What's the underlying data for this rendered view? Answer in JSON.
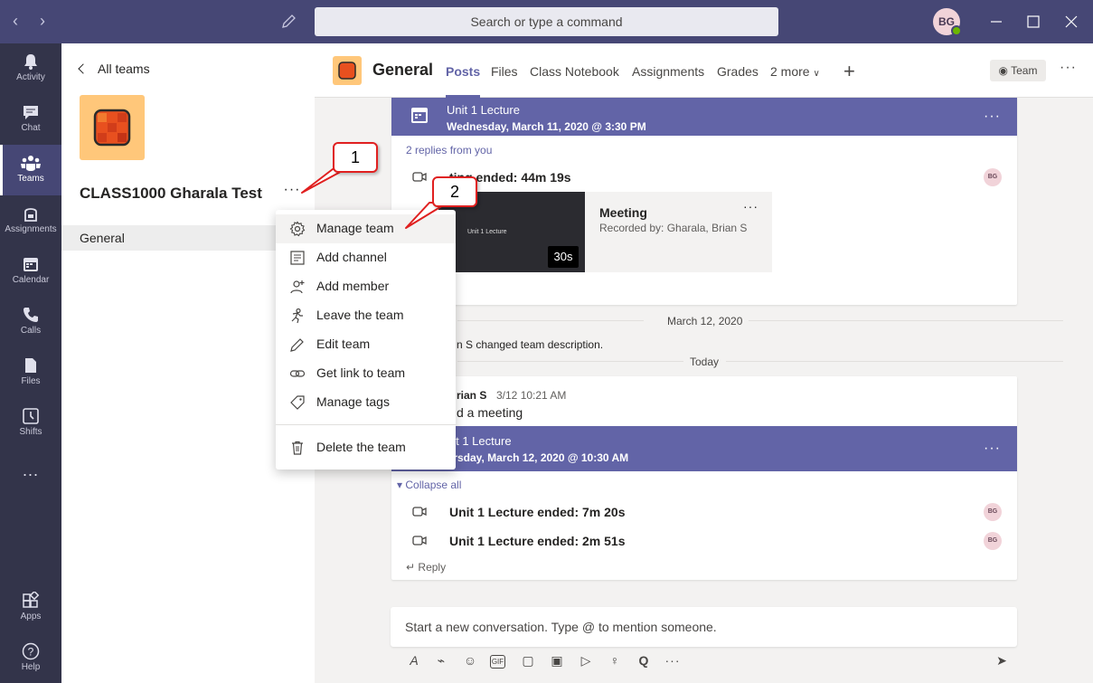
{
  "titlebar": {
    "search_placeholder": "Search or type a command",
    "avatar_initials": "BG"
  },
  "rail": {
    "items": [
      {
        "label": "Activity",
        "icon": "bell-icon"
      },
      {
        "label": "Chat",
        "icon": "chat-icon"
      },
      {
        "label": "Teams",
        "icon": "teams-icon",
        "active": true
      },
      {
        "label": "Assignments",
        "icon": "assignments-icon"
      },
      {
        "label": "Calendar",
        "icon": "calendar-icon"
      },
      {
        "label": "Calls",
        "icon": "phone-icon"
      },
      {
        "label": "Files",
        "icon": "file-icon"
      },
      {
        "label": "Shifts",
        "icon": "clock-icon"
      },
      {
        "label": "...",
        "icon": "more-icon"
      }
    ],
    "bottom": [
      {
        "label": "Apps",
        "icon": "apps-icon"
      },
      {
        "label": "Help",
        "icon": "help-icon"
      }
    ]
  },
  "team_panel": {
    "all_teams": "All teams",
    "team_name": "CLASS1000 Gharala Test",
    "more": "···",
    "channels": [
      "General"
    ]
  },
  "channel": {
    "title": "General",
    "tabs": [
      "Posts",
      "Files",
      "Class Notebook",
      "Assignments",
      "Grades",
      "2 more"
    ],
    "team_button": "Team",
    "more": "···"
  },
  "menu": {
    "items": [
      {
        "label": "Manage team",
        "icon": "gear-icon"
      },
      {
        "label": "Add channel",
        "icon": "channel-icon"
      },
      {
        "label": "Add member",
        "icon": "add-member-icon"
      },
      {
        "label": "Leave the team",
        "icon": "leave-icon"
      },
      {
        "label": "Edit team",
        "icon": "pencil-icon"
      },
      {
        "label": "Get link to team",
        "icon": "link-icon"
      },
      {
        "label": "Manage tags",
        "icon": "tag-icon"
      },
      {
        "label": "Delete the team",
        "icon": "trash-icon"
      }
    ]
  },
  "callouts": [
    "1",
    "2"
  ],
  "posts": {
    "meeting1": {
      "title": "Unit 1 Lecture",
      "when": "Wednesday, March 11, 2020 @ 3:30 PM",
      "replies": "2 replies from you",
      "ended": "Meeting ended: 44m 19s",
      "ended_visible": "ting ended: 44m 19s",
      "recording_title": "Meeting",
      "recording_by": "Recorded by: Gharala, Brian S",
      "duration": "30s",
      "thumb_title": "Unit 1 Lecture"
    },
    "date1": "March 12, 2020",
    "sys_msg": "n S changed team description.",
    "date2": "Today",
    "post2": {
      "author": "rian S",
      "time": "3/12 10:21 AM",
      "text": "d a meeting"
    },
    "meeting2": {
      "title": "nit 1 Lecture",
      "when": "ursday, March 12, 2020 @ 10:30 AM",
      "collapse": "Collapse all",
      "ended1": "Unit 1 Lecture ended: 7m 20s",
      "ended2": "Unit 1 Lecture ended: 2m 51s",
      "reply": "Reply"
    },
    "chip": "BG"
  },
  "compose": {
    "placeholder": "Start a new conversation. Type @ to mention someone."
  }
}
